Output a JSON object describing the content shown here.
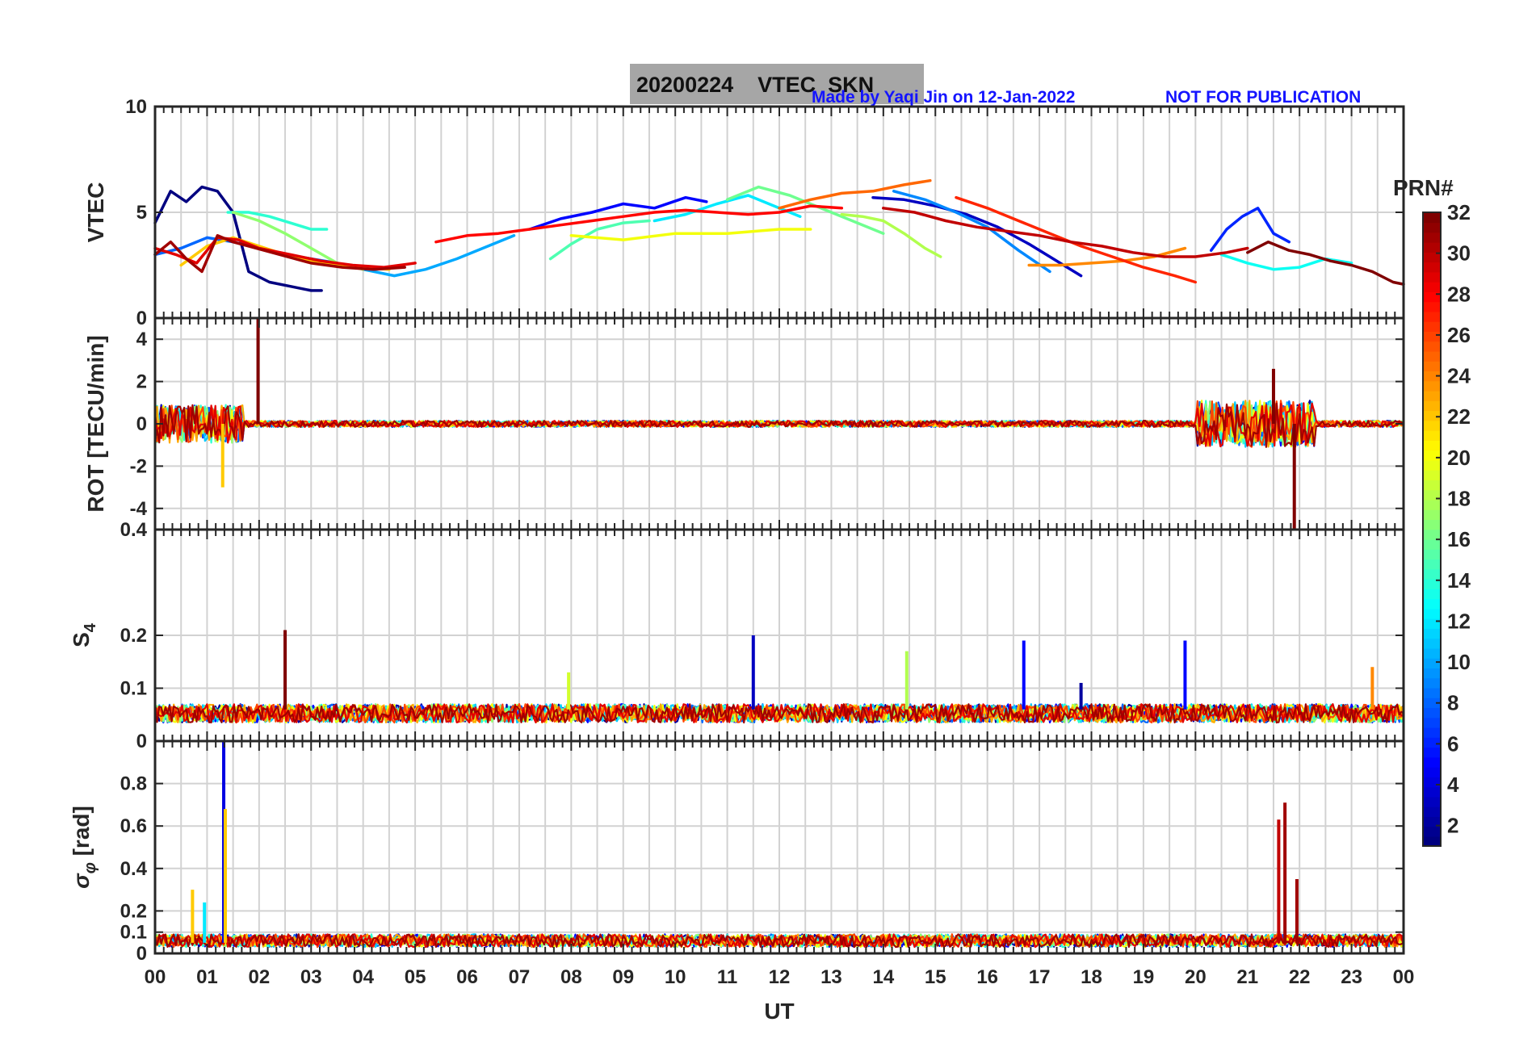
{
  "figure": {
    "title_date": "20200224",
    "title_name": "VTEC  SKN",
    "credit_text": "Made by Yaqi Jin on 12-Jan-2022",
    "notice_text": "NOT FOR PUBLICATION",
    "credit_color": "#1414ff",
    "title_bg": "#a6a6a6"
  },
  "x_axis": {
    "label": "UT",
    "ticks": [
      "00",
      "01",
      "02",
      "03",
      "04",
      "05",
      "06",
      "07",
      "08",
      "09",
      "10",
      "11",
      "12",
      "13",
      "14",
      "15",
      "16",
      "17",
      "18",
      "19",
      "20",
      "21",
      "22",
      "23",
      "00"
    ],
    "range_hours": [
      0,
      24
    ]
  },
  "colorbar": {
    "label": "PRN#",
    "ticks": [
      "2",
      "4",
      "6",
      "8",
      "10",
      "12",
      "14",
      "16",
      "18",
      "20",
      "22",
      "24",
      "26",
      "28",
      "30",
      "32"
    ],
    "range": [
      1,
      32
    ],
    "colormap": "jet"
  },
  "chart_data": [
    {
      "type": "line",
      "panel": "vtec",
      "ylabel": "VTEC",
      "ylim": [
        0,
        10
      ],
      "yticks": [
        "0",
        "5",
        "10"
      ],
      "grid": true,
      "series": [
        {
          "prn": 1,
          "x": [
            0.0,
            0.3,
            0.6,
            0.9,
            1.2,
            1.5,
            1.8,
            2.2,
            2.6,
            3.0,
            3.2
          ],
          "y": [
            4.5,
            6.0,
            5.5,
            6.2,
            6.0,
            5.0,
            2.2,
            1.7,
            1.5,
            1.3,
            1.3
          ]
        },
        {
          "prn": 3,
          "x": [
            13.8,
            14.4,
            15.0,
            15.6,
            16.2,
            16.8,
            17.4,
            17.8
          ],
          "y": [
            5.7,
            5.6,
            5.3,
            4.9,
            4.3,
            3.5,
            2.6,
            2.0
          ]
        },
        {
          "prn": 5,
          "x": [
            7.2,
            7.8,
            8.4,
            9.0,
            9.6,
            10.2,
            10.6
          ],
          "y": [
            4.2,
            4.7,
            5.0,
            5.4,
            5.2,
            5.7,
            5.5
          ]
        },
        {
          "prn": 6,
          "x": [
            20.3,
            20.6,
            20.9,
            21.2,
            21.5,
            21.8
          ],
          "y": [
            3.2,
            4.2,
            4.8,
            5.2,
            4.0,
            3.6
          ]
        },
        {
          "prn": 8,
          "x": [
            0.0,
            0.5,
            1.0,
            1.5,
            2.0,
            2.5,
            3.0,
            3.5
          ],
          "y": [
            3.0,
            3.3,
            3.8,
            3.6,
            3.3,
            3.0,
            2.8,
            2.6
          ]
        },
        {
          "prn": 9,
          "x": [
            14.2,
            14.8,
            15.4,
            16.0,
            16.6,
            17.2
          ],
          "y": [
            6.0,
            5.6,
            5.0,
            4.3,
            3.2,
            2.2
          ]
        },
        {
          "prn": 10,
          "x": [
            4.0,
            4.6,
            5.2,
            5.8,
            6.4,
            6.9
          ],
          "y": [
            2.3,
            2.0,
            2.3,
            2.8,
            3.4,
            3.9
          ]
        },
        {
          "prn": 12,
          "x": [
            9.6,
            10.2,
            10.8,
            11.4,
            12.0,
            12.4
          ],
          "y": [
            4.6,
            4.9,
            5.4,
            5.8,
            5.2,
            4.8
          ]
        },
        {
          "prn": 13,
          "x": [
            20.5,
            21.0,
            21.5,
            22.0,
            22.5,
            23.0
          ],
          "y": [
            3.0,
            2.6,
            2.3,
            2.4,
            2.8,
            2.6
          ]
        },
        {
          "prn": 14,
          "x": [
            1.4,
            1.8,
            2.2,
            2.6,
            3.0,
            3.3
          ],
          "y": [
            5.0,
            5.0,
            4.8,
            4.5,
            4.2,
            4.2
          ]
        },
        {
          "prn": 15,
          "x": [
            7.6,
            8.0,
            8.5,
            9.0,
            9.5
          ],
          "y": [
            2.8,
            3.5,
            4.2,
            4.5,
            4.6
          ]
        },
        {
          "prn": 16,
          "x": [
            11.0,
            11.6,
            12.2,
            12.8,
            13.4,
            14.0
          ],
          "y": [
            5.6,
            6.2,
            5.8,
            5.2,
            4.6,
            4.0
          ]
        },
        {
          "prn": 17,
          "x": [
            1.5,
            2.0,
            2.5,
            3.0,
            3.5,
            4.0
          ],
          "y": [
            5.0,
            4.6,
            4.0,
            3.3,
            2.6,
            2.3
          ]
        },
        {
          "prn": 18,
          "x": [
            13.2,
            13.6,
            14.0,
            14.4,
            14.8,
            15.1
          ],
          "y": [
            4.9,
            4.8,
            4.6,
            4.0,
            3.3,
            2.9
          ]
        },
        {
          "prn": 20,
          "x": [
            8.0,
            9.0,
            10.0,
            11.0,
            12.0,
            12.6
          ],
          "y": [
            3.9,
            3.7,
            4.0,
            4.0,
            4.2,
            4.2
          ]
        },
        {
          "prn": 22,
          "x": [
            0.5,
            1.0,
            1.5,
            2.0,
            2.5,
            3.0,
            3.5,
            4.0,
            4.5
          ],
          "y": [
            2.5,
            3.4,
            3.8,
            3.4,
            3.0,
            2.7,
            2.5,
            2.4,
            2.3
          ]
        },
        {
          "prn": 24,
          "x": [
            16.8,
            17.4,
            18.0,
            18.6,
            19.2,
            19.8
          ],
          "y": [
            2.5,
            2.5,
            2.6,
            2.7,
            2.9,
            3.3
          ]
        },
        {
          "prn": 25,
          "x": [
            12.0,
            12.6,
            13.2,
            13.8,
            14.4,
            14.9
          ],
          "y": [
            5.2,
            5.6,
            5.9,
            6.0,
            6.3,
            6.5
          ]
        },
        {
          "prn": 27,
          "x": [
            15.4,
            16.0,
            16.6,
            17.2,
            17.8,
            18.4,
            19.0,
            19.6,
            20.0
          ],
          "y": [
            5.7,
            5.2,
            4.6,
            4.0,
            3.4,
            2.9,
            2.4,
            2.0,
            1.7
          ]
        },
        {
          "prn": 28,
          "x": [
            5.4,
            6.0,
            6.6,
            7.2,
            7.8,
            8.4,
            9.0,
            9.6,
            10.2,
            10.8,
            11.4,
            12.0,
            12.6,
            13.2
          ],
          "y": [
            3.6,
            3.9,
            4.0,
            4.2,
            4.4,
            4.6,
            4.8,
            5.0,
            5.1,
            5.0,
            4.9,
            5.0,
            5.3,
            5.2
          ]
        },
        {
          "prn": 29,
          "x": [
            0.0,
            0.4,
            0.8,
            1.2,
            1.6,
            2.0,
            2.6,
            3.2,
            3.8,
            4.4,
            5.0
          ],
          "y": [
            3.3,
            3.0,
            2.6,
            3.8,
            3.7,
            3.3,
            3.0,
            2.7,
            2.5,
            2.4,
            2.6
          ]
        },
        {
          "prn": 30,
          "x": [
            14.0,
            14.6,
            15.2,
            15.8,
            16.4,
            17.0,
            17.6,
            18.2,
            18.8,
            19.4,
            20.0,
            20.6,
            21.0
          ],
          "y": [
            5.2,
            5.0,
            4.6,
            4.3,
            4.1,
            3.9,
            3.6,
            3.4,
            3.1,
            2.9,
            2.9,
            3.1,
            3.3
          ]
        },
        {
          "prn": 31,
          "x": [
            0.0,
            0.3,
            0.6,
            0.9,
            1.2,
            1.5,
            1.8,
            2.4,
            3.0,
            3.6,
            4.2,
            4.8
          ],
          "y": [
            3.0,
            3.6,
            2.8,
            2.2,
            3.9,
            3.6,
            3.4,
            3.0,
            2.6,
            2.4,
            2.3,
            2.4
          ]
        },
        {
          "prn": 32,
          "x": [
            21.0,
            21.4,
            21.8,
            22.2,
            22.6,
            23.0,
            23.4,
            23.8,
            24.0
          ],
          "y": [
            3.1,
            3.6,
            3.2,
            3.0,
            2.7,
            2.5,
            2.2,
            1.7,
            1.6
          ]
        }
      ]
    },
    {
      "type": "line",
      "panel": "rot",
      "ylabel": "ROT [TECU/min]",
      "ylim": [
        -5,
        5
      ],
      "yticks": [
        "-4",
        "-2",
        "0",
        "2",
        "4"
      ],
      "grid": true,
      "note": "noise around 0 (±0.2) with bursts 00:00–01:40 (±2) and 20:00–22:20 (±2.5); spikes at 02:00 (+5) and 21:55 (-5)",
      "spikes": [
        {
          "prn": 32,
          "x": 1.98,
          "y": 5.0
        },
        {
          "prn": 22,
          "x": 1.3,
          "y": -3.0
        },
        {
          "prn": 32,
          "x": 21.9,
          "y": -5.0
        },
        {
          "prn": 32,
          "x": 21.5,
          "y": 2.6
        }
      ]
    },
    {
      "type": "line",
      "panel": "s4",
      "ylabel": "S4",
      "ylim": [
        0,
        0.4
      ],
      "yticks": [
        "0",
        "0.1",
        "0.2",
        "0.4"
      ],
      "grid": true,
      "note": "baseline 0.03–0.08 across the day",
      "spikes": [
        {
          "prn": 32,
          "x": 2.5,
          "y": 0.21
        },
        {
          "prn": 3,
          "x": 11.5,
          "y": 0.2
        },
        {
          "prn": 18,
          "x": 14.45,
          "y": 0.17
        },
        {
          "prn": 5,
          "x": 16.7,
          "y": 0.19
        },
        {
          "prn": 5,
          "x": 19.8,
          "y": 0.19
        },
        {
          "prn": 24,
          "x": 23.4,
          "y": 0.14
        },
        {
          "prn": 19,
          "x": 7.95,
          "y": 0.13
        },
        {
          "prn": 2,
          "x": 17.8,
          "y": 0.11
        }
      ]
    },
    {
      "type": "line",
      "panel": "sigma_phi",
      "ylabel": "σ_φ [rad]",
      "ylim": [
        0,
        1.0
      ],
      "yticks": [
        "0",
        "0.1",
        "0.2",
        "0.4",
        "0.6",
        "0.8"
      ],
      "grid": true,
      "note": "baseline 0.02–0.12 across the day",
      "spikes": [
        {
          "prn": 4,
          "x": 1.32,
          "y": 1.0
        },
        {
          "prn": 22,
          "x": 1.35,
          "y": 0.68
        },
        {
          "prn": 22,
          "x": 0.72,
          "y": 0.3
        },
        {
          "prn": 12,
          "x": 0.95,
          "y": 0.24
        },
        {
          "prn": 30,
          "x": 21.6,
          "y": 0.63
        },
        {
          "prn": 31,
          "x": 21.72,
          "y": 0.71
        },
        {
          "prn": 31,
          "x": 21.95,
          "y": 0.35
        }
      ]
    }
  ]
}
